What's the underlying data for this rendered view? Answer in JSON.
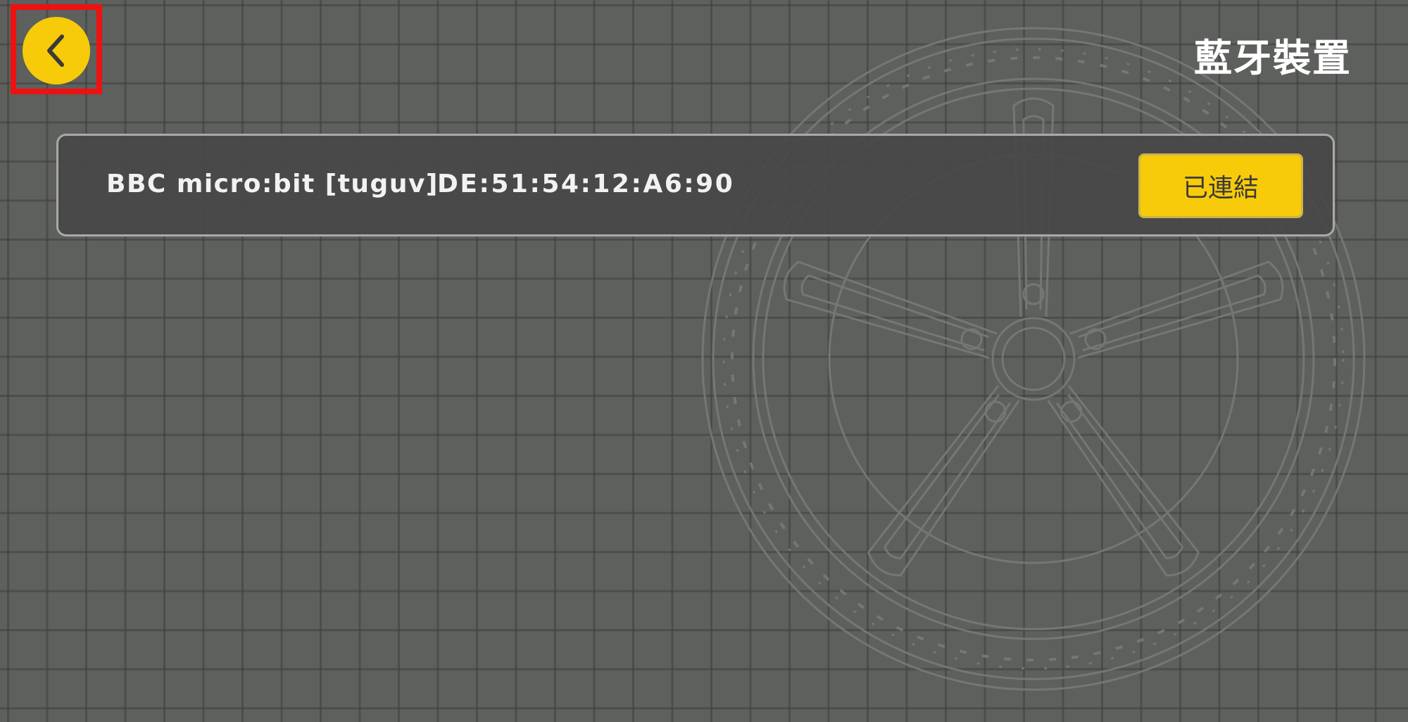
{
  "header": {
    "back_icon": "chevron-left-icon",
    "title": "藍牙裝置"
  },
  "device": {
    "name": "BBC micro:bit [tuguv]",
    "address": "DE:51:54:12:A6:90",
    "status_label": "已連結"
  },
  "colors": {
    "background": "#5d605c",
    "accent": "#f7cb0a",
    "highlight": "#ee1111",
    "card": "#484848"
  }
}
